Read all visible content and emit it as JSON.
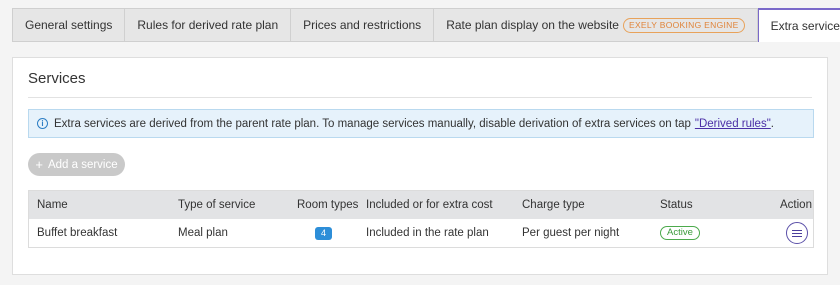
{
  "tabs": [
    {
      "label": "General settings"
    },
    {
      "label": "Rules for derived rate plan"
    },
    {
      "label": "Prices and restrictions"
    },
    {
      "label": "Rate plan display on the website",
      "badge": "EXELY BOOKING ENGINE"
    },
    {
      "label": "Extra services"
    }
  ],
  "active_tab": "Extra services",
  "panel": {
    "title": "Services",
    "info_text": "Extra services are derived from the parent rate plan. To manage services manually, disable derivation of extra services on tap",
    "info_link": "\"Derived rules\"",
    "info_suffix": ".",
    "add_button": "Add a service"
  },
  "table": {
    "columns": [
      "Name",
      "Type of service",
      "Room types",
      "Included or for extra cost",
      "Charge type",
      "Status",
      "Action"
    ],
    "rows": [
      {
        "name": "Buffet breakfast",
        "type": "Meal plan",
        "room_types": "4",
        "included": "Included in the rate plan",
        "charge_type": "Per guest per night",
        "status": "Active"
      }
    ]
  },
  "colors": {
    "accent": "#7a69c9",
    "info_bg": "#e6f2fb",
    "status_active": "#4caa4c",
    "badge_blue": "#2d8ed8"
  }
}
